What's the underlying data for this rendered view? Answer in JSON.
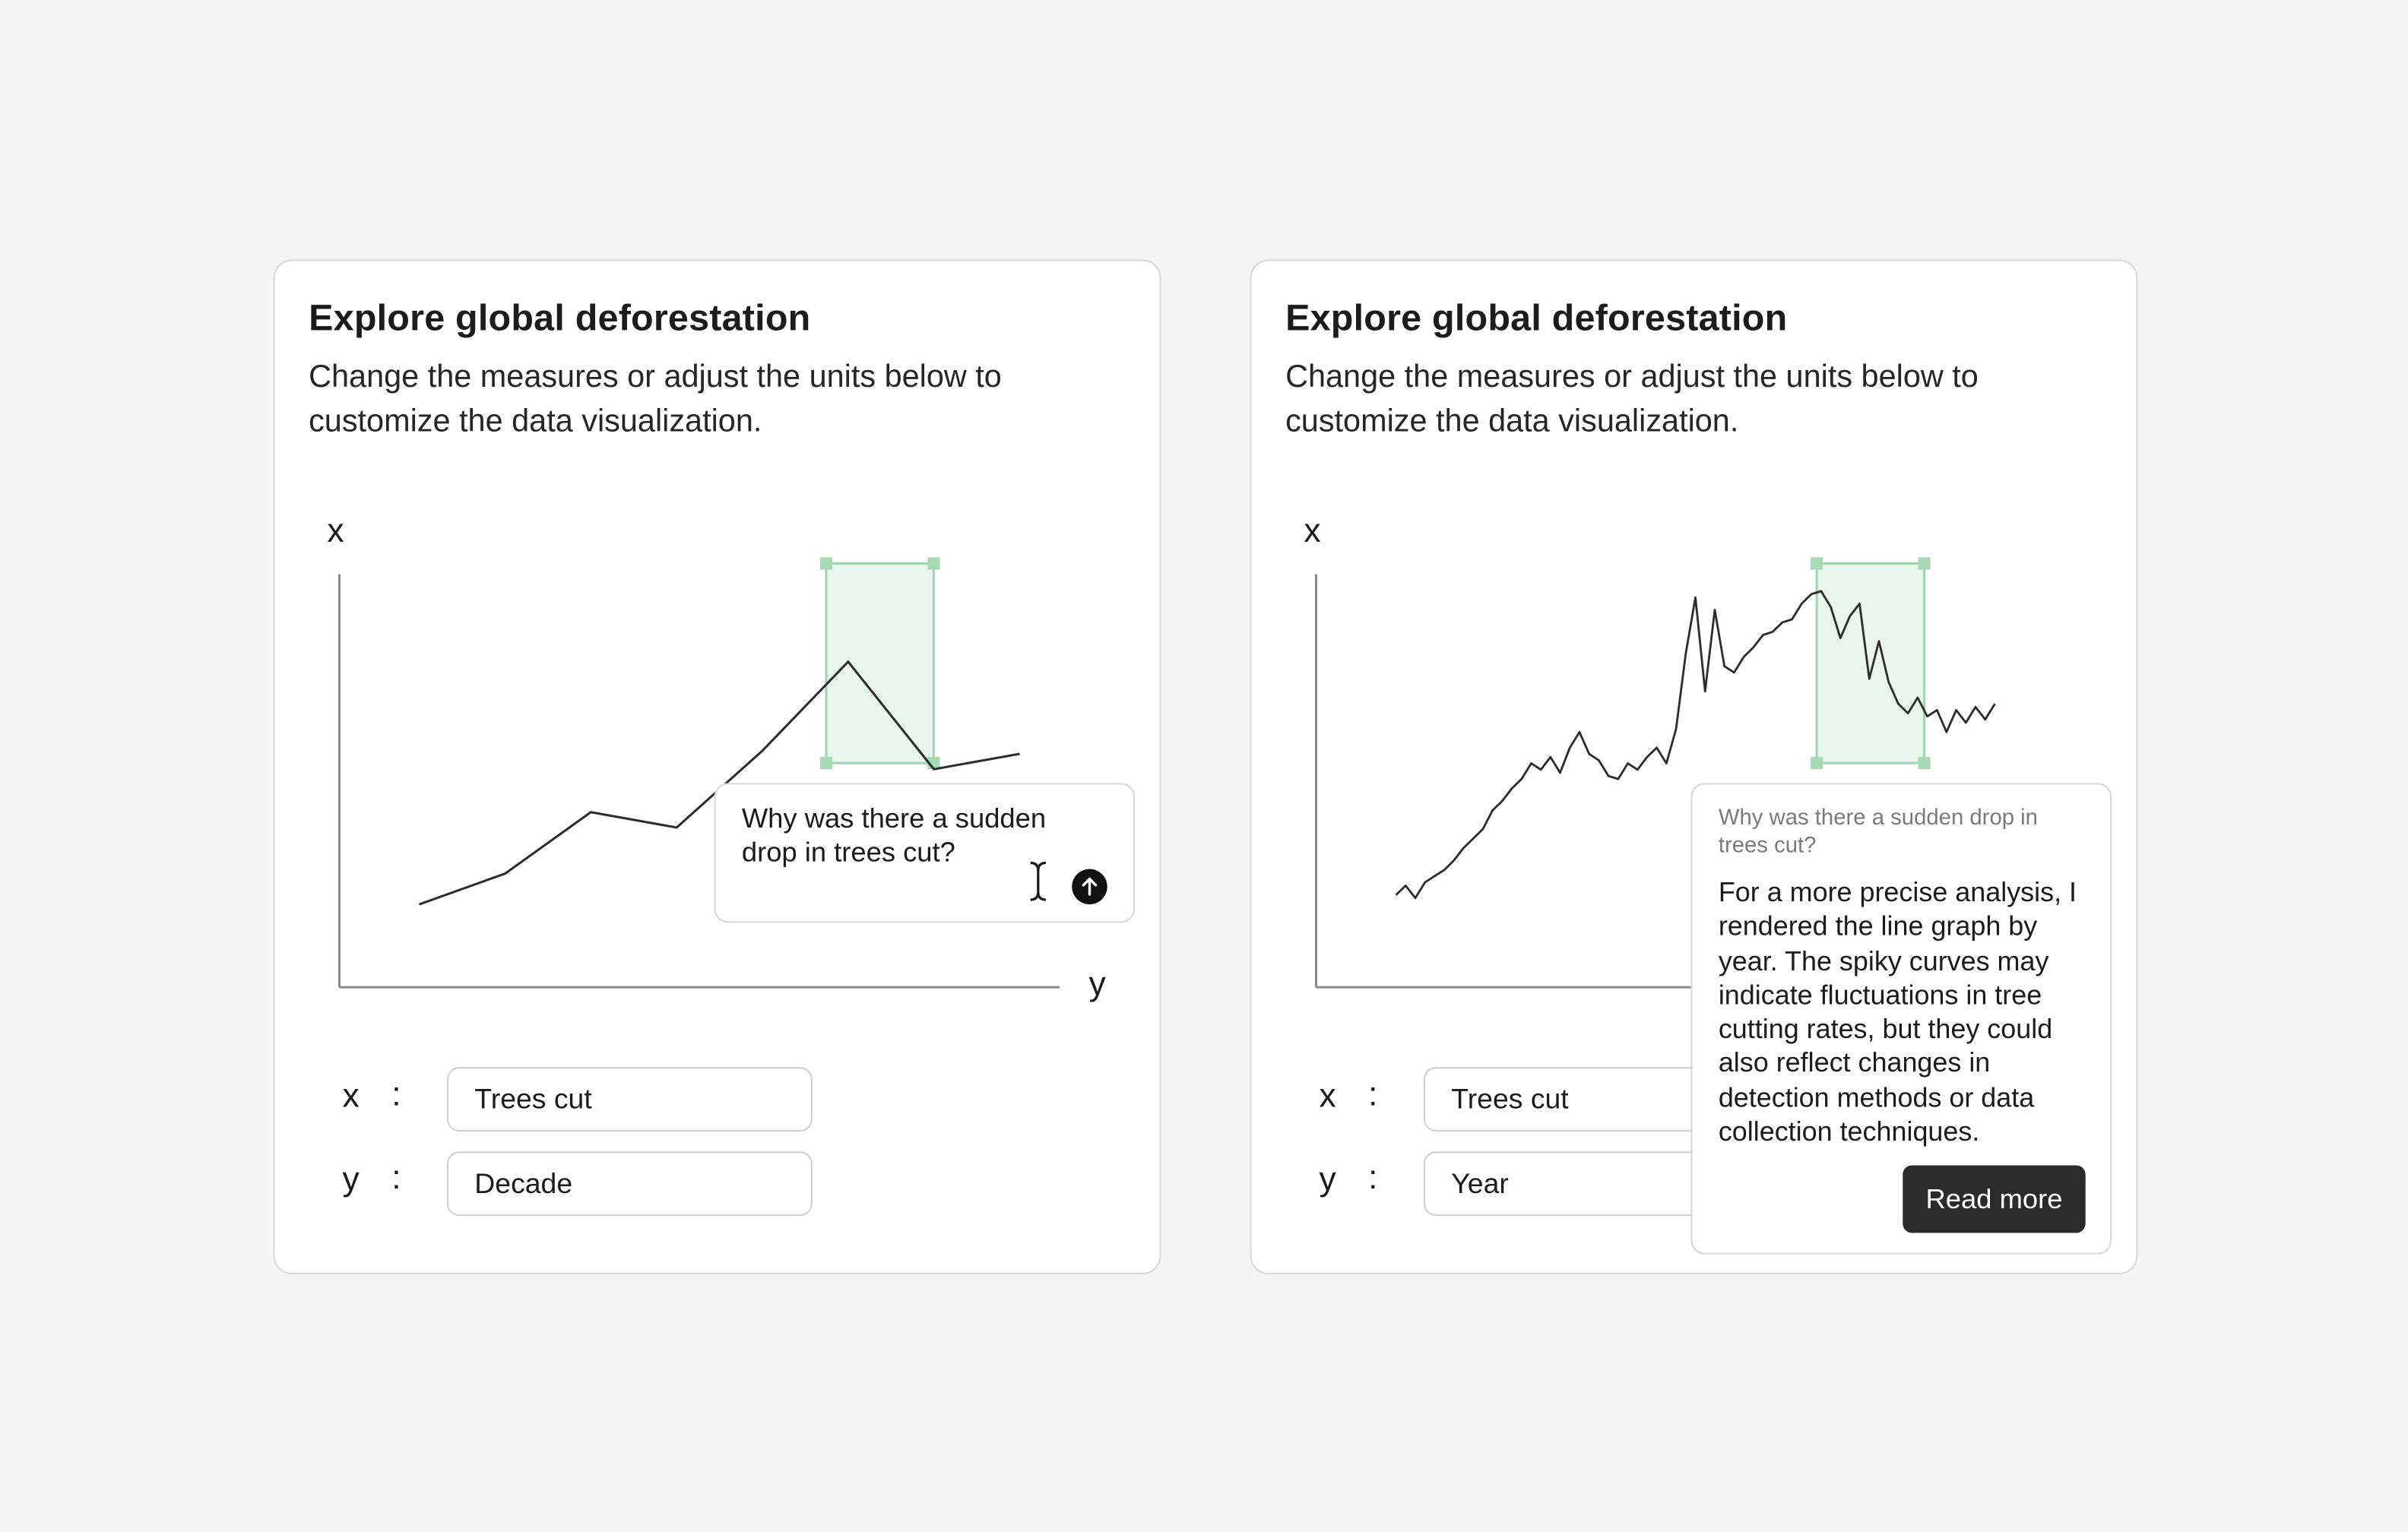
{
  "panels": [
    {
      "title": "Explore global deforestation",
      "description": "Change the measures or adjust the units below to customize the data visualization.",
      "chart_axis_x_label": "x",
      "chart_axis_y_label": "y",
      "fields": [
        {
          "axis": "x",
          "separator": ":",
          "value": "Trees cut"
        },
        {
          "axis": "y",
          "separator": ":",
          "value": "Decade"
        }
      ],
      "prompt": {
        "text": "Why was there a sudden drop in trees cut?",
        "send_icon": "arrow-up-icon",
        "cursor_icon": "text-cursor-icon"
      }
    },
    {
      "title": "Explore global deforestation",
      "description": "Change the measures or adjust the units below to customize the data visualization.",
      "chart_axis_x_label": "x",
      "chart_axis_y_label": "y",
      "fields": [
        {
          "axis": "x",
          "separator": ":",
          "value": "Trees cut"
        },
        {
          "axis": "y",
          "separator": ":",
          "value": "Year"
        }
      ],
      "answer": {
        "question": "Why was there a sudden drop in trees cut?",
        "body": "For a more precise analysis, I rendered the line graph by year. The spiky curves may indicate fluctuations in tree cutting rates, but they could also reflect changes in detection methods or data collection techniques.",
        "button_label": "Read more"
      }
    }
  ],
  "colors": {
    "background": "#f4f4f4",
    "card": "#ffffff",
    "selection_fill": "#e9f6ec",
    "selection_stroke": "#9fd4ae",
    "line": "#2d2d2d",
    "button": "#2b2b2b"
  },
  "chart_data": [
    {
      "type": "line",
      "series": [
        {
          "values": [
            0.0,
            0.1,
            0.3,
            0.25,
            0.5,
            0.79,
            0.44,
            0.49
          ]
        }
      ],
      "highlight_range_index": [
        6,
        7
      ],
      "grid": false
    },
    {
      "type": "line",
      "series": [
        {
          "values": [
            0.03,
            0.06,
            0.02,
            0.07,
            0.09,
            0.11,
            0.14,
            0.18,
            0.21,
            0.24,
            0.3,
            0.33,
            0.37,
            0.4,
            0.45,
            0.43,
            0.47,
            0.42,
            0.5,
            0.55,
            0.48,
            0.46,
            0.41,
            0.4,
            0.45,
            0.43,
            0.47,
            0.5,
            0.45,
            0.56,
            0.8,
            0.98,
            0.68,
            0.94,
            0.76,
            0.74,
            0.79,
            0.82,
            0.86,
            0.87,
            0.9,
            0.91,
            0.96,
            0.99,
            1.0,
            0.95,
            0.85,
            0.92,
            0.96,
            0.72,
            0.84,
            0.71,
            0.64,
            0.61,
            0.66,
            0.6,
            0.62,
            0.55,
            0.62,
            0.58,
            0.63,
            0.59,
            0.64
          ]
        }
      ],
      "highlight_range_index": [
        45,
        55
      ],
      "grid": false
    }
  ]
}
